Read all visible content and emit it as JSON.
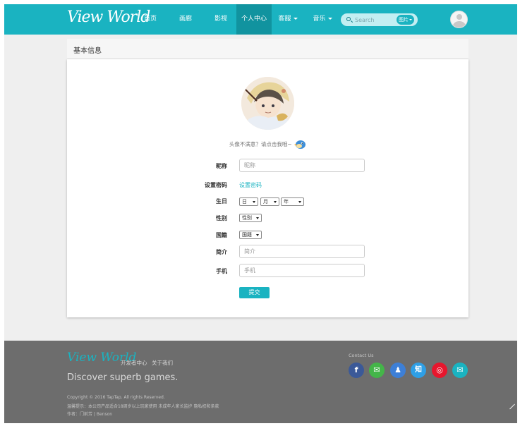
{
  "header": {
    "logo": "View World",
    "nav": [
      {
        "label": "首页",
        "dropdown": false,
        "active": false
      },
      {
        "label": "画廊",
        "dropdown": false,
        "active": false
      },
      {
        "label": "影视",
        "dropdown": false,
        "active": false
      },
      {
        "label": "个人中心",
        "dropdown": false,
        "active": true
      },
      {
        "label": "客服",
        "dropdown": true,
        "active": false
      },
      {
        "label": "音乐",
        "dropdown": true,
        "active": false
      }
    ],
    "search": {
      "placeholder": "Search",
      "type_label": "图片"
    },
    "colors": {
      "brand": "#1ab3c1",
      "active": "#11939f"
    }
  },
  "main": {
    "title": "基本信息",
    "avatar_hint": "头像不满意？请点击我哦~",
    "fields": {
      "nickname": {
        "label": "昵称",
        "placeholder": "昵称"
      },
      "password": {
        "label": "设置密码",
        "link": "设置密码"
      },
      "birthday": {
        "label": "生日",
        "day": "日",
        "month": "月",
        "year": "年"
      },
      "gender": {
        "label": "性别",
        "value": "性别"
      },
      "nationality": {
        "label": "国籍",
        "value": "国籍"
      },
      "bio": {
        "label": "简介",
        "placeholder": "简介"
      },
      "phone": {
        "label": "手机",
        "placeholder": "手机"
      }
    },
    "submit": "提交"
  },
  "footer": {
    "logo": "View World",
    "links": [
      "开发者中心",
      "关于我们"
    ],
    "slogan": "Discover superb games.",
    "copyright": "Copyright © 2016 TapTap. All rights Reserved.",
    "notice": "温馨提示：本公司产品适合18周岁以上玩家使用  未成年人家长监护  隐私权和条款",
    "author": "作者：门前芳 | Benson",
    "contact_title": "Contact Us",
    "social": [
      {
        "icon": "facebook-icon",
        "glyph": "f",
        "color": "#3b5998"
      },
      {
        "icon": "wechat-icon",
        "glyph": "✉",
        "color": "#44b549"
      },
      {
        "icon": "qq-icon",
        "glyph": "♟",
        "color": "#3d7fd6"
      },
      {
        "icon": "zhihu-icon",
        "glyph": "知",
        "color": "#2e9fe6"
      },
      {
        "icon": "weibo-icon",
        "glyph": "◎",
        "color": "#e6162d"
      },
      {
        "icon": "mail-icon",
        "glyph": "✉",
        "color": "#1ab3c1"
      }
    ]
  }
}
